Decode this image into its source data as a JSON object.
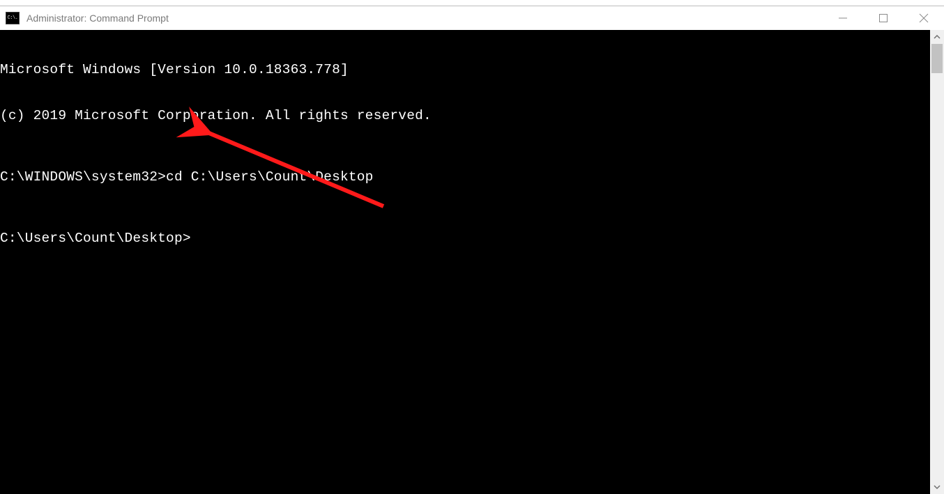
{
  "window": {
    "title": "Administrator: Command Prompt",
    "icon_glyph": "C:\\."
  },
  "terminal": {
    "lines": [
      "Microsoft Windows [Version 10.0.18363.778]",
      "(c) 2019 Microsoft Corporation. All rights reserved.",
      "",
      "C:\\WINDOWS\\system32>cd C:\\Users\\Count\\Desktop",
      "",
      "C:\\Users\\Count\\Desktop>"
    ]
  },
  "annotation": {
    "arrow_color": "#ff1a1a"
  }
}
